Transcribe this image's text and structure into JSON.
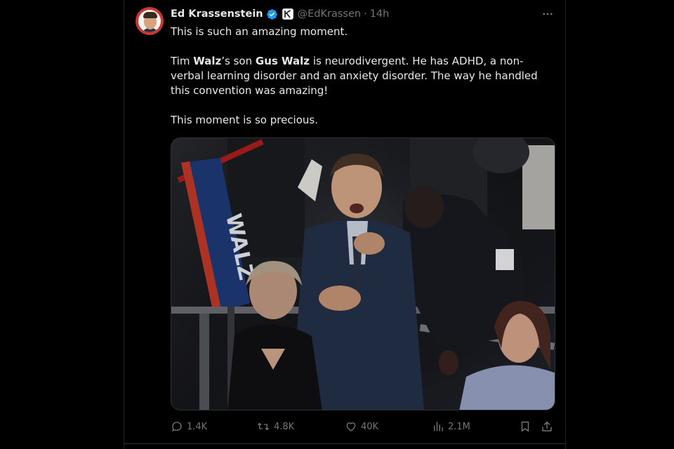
{
  "tweet": {
    "author": {
      "display_name": "Ed Krassenstein",
      "handle": "@EdKrassen",
      "verified": true,
      "affiliate_badge": "K"
    },
    "separator": "·",
    "time": "14h",
    "text": {
      "line1": "This is such an amazing moment.",
      "para2_part1": "Tim ",
      "para2_bold1": "Walz",
      "para2_part2": "’s son ",
      "para2_bold2": "Gus Walz",
      "para2_part3": " is neurodivergent. He has ADHD, a non-verbal learning disorder and an anxiety disorder. The way he handled this convention was amazing!",
      "para3": "This moment is so precious."
    },
    "media": {
      "sign_text": "WALZ"
    },
    "metrics": {
      "replies": "1.4K",
      "reposts": "4.8K",
      "likes": "40K",
      "views": "2.1M"
    }
  },
  "icons": {
    "more": "more-horizontal-icon",
    "reply": "reply-icon",
    "repost": "repost-icon",
    "like": "heart-icon",
    "views": "views-icon",
    "bookmark": "bookmark-icon",
    "share": "share-icon"
  },
  "colors": {
    "background": "#000000",
    "text_primary": "#e7e9ea",
    "text_secondary": "#71767b",
    "verified_blue": "#1d9bf0",
    "border": "#2f3336"
  }
}
